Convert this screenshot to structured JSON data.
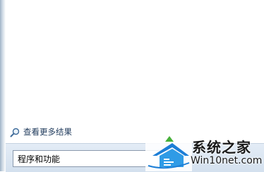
{
  "start_menu": {
    "see_more_results": "查看更多结果",
    "search_value": "程序和功能"
  },
  "watermark": {
    "title": "系统之家",
    "url": "Win10net.com"
  },
  "icons": {
    "see_more": "magnifier-icon",
    "logo": "house-logo-icon"
  }
}
